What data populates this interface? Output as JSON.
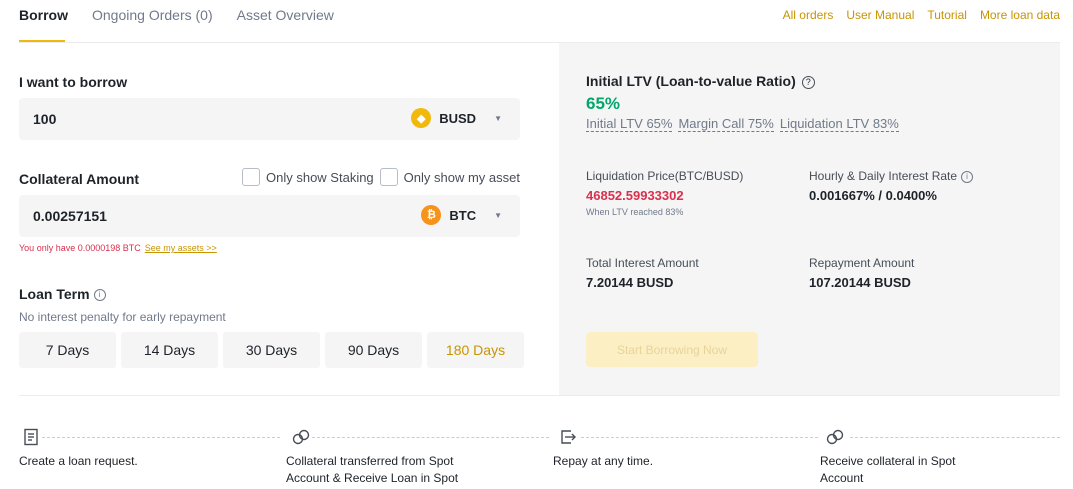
{
  "tabs": [
    {
      "label": "Borrow"
    },
    {
      "label": "Ongoing Orders (0)"
    },
    {
      "label": "Asset Overview"
    }
  ],
  "top_links": [
    {
      "label": "All orders"
    },
    {
      "label": "User Manual"
    },
    {
      "label": "Tutorial"
    },
    {
      "label": "More loan data"
    }
  ],
  "borrow": {
    "label": "I want to borrow",
    "value": "100",
    "coin": "BUSD",
    "coin_icon": "busd-icon"
  },
  "collateral": {
    "label": "Collateral Amount",
    "only_staking": "Only show Staking",
    "only_my_asset": "Only show my asset",
    "value": "0.00257151",
    "coin": "BTC",
    "coin_icon": "btc-icon",
    "warning": "You only have 0.0000198 BTC",
    "see_assets": "See my assets >>"
  },
  "loan_term": {
    "label": "Loan Term",
    "subtitle": "No interest penalty for early repayment",
    "options": [
      "7 Days",
      "14 Days",
      "30 Days",
      "90 Days",
      "180 Days"
    ],
    "selected": "180 Days"
  },
  "summary": {
    "ltv_title": "Initial LTV (Loan-to-value Ratio)",
    "ltv_value": "65%",
    "ltv_initial": "Initial LTV 65%",
    "ltv_margin_call": "Margin Call 75%",
    "ltv_liquidation": "Liquidation LTV 83%",
    "liq_price_label": "Liquidation Price(BTC/BUSD)",
    "liq_price_value": "46852.59933302",
    "liq_note": "When LTV reached 83%",
    "rate_label": "Hourly & Daily Interest Rate",
    "rate_value": "0.001667% / 0.0400%",
    "total_interest_label": "Total Interest Amount",
    "total_interest_value": "7.20144 BUSD",
    "repayment_label": "Repayment Amount",
    "repayment_value": "107.20144 BUSD",
    "start_button": "Start Borrowing Now"
  },
  "steps": [
    {
      "icon": "receipt-icon",
      "text": "Create a loan request."
    },
    {
      "icon": "collateral-icon",
      "text": "Collateral transferred from Spot Account & Receive Loan in Spot"
    },
    {
      "icon": "repay-icon",
      "text": "Repay at any time."
    },
    {
      "icon": "collateral-icon",
      "text": "Receive collateral in Spot Account"
    }
  ],
  "colors": {
    "accent": "#f0b90b",
    "link": "#c99400",
    "green": "#03a66d",
    "red": "#d9304e",
    "busd": "#f0b90b",
    "btc": "#f7931a"
  }
}
